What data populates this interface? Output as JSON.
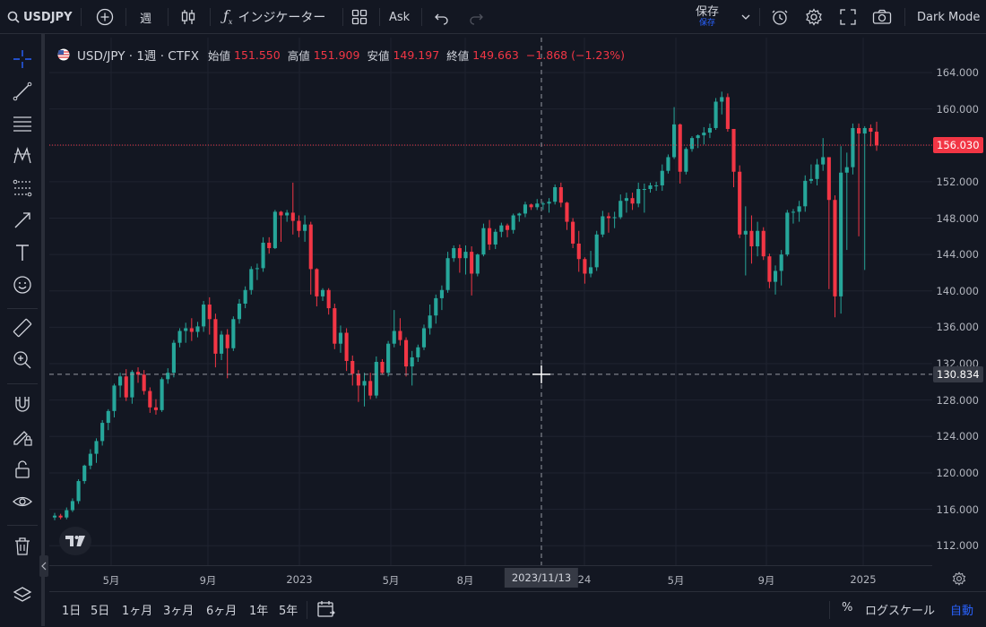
{
  "toolbar": {
    "symbol": "USDJPY",
    "interval": "週",
    "indicators": "インジケーター",
    "ask": "Ask",
    "save": "保存",
    "save_sub": "保存",
    "theme": "Dark Mode"
  },
  "legend": {
    "title": "USD/JPY · 1週 · CTFX",
    "open_label": "始値",
    "open": "151.550",
    "high_label": "高値",
    "high": "151.909",
    "low_label": "安値",
    "low": "149.197",
    "close_label": "終値",
    "close": "149.663",
    "change": "−1.868 (−1.23%)"
  },
  "price_axis": [
    "164.000",
    "160.000",
    "156.000",
    "152.000",
    "148.000",
    "144.000",
    "140.000",
    "136.000",
    "132.000",
    "128.000",
    "124.000",
    "120.000",
    "116.000",
    "112.000"
  ],
  "time_axis": [
    "5月",
    "9月",
    "2023",
    "5月",
    "8月",
    "24",
    "5月",
    "9月",
    "2025"
  ],
  "crosshair": {
    "price": "130.834",
    "date": "2023/11/13"
  },
  "last_price": "156.030",
  "bottom": {
    "ranges": [
      "1日",
      "5日",
      "1ヶ月",
      "3ヶ月",
      "6ヶ月",
      "1年",
      "5年"
    ],
    "percent": "%",
    "log": "ログスケール",
    "auto": "自動"
  },
  "colors": {
    "up": "#26a69a",
    "down": "#f23645",
    "bg": "#131722",
    "grid": "#1f2330",
    "auto": "#2962ff"
  },
  "chart_data": {
    "type": "candlestick",
    "symbol": "USD/JPY",
    "interval": "1週",
    "ylim": [
      110,
      166
    ],
    "candles": [
      [
        115.1,
        115.6,
        114.8,
        115.3
      ],
      [
        115.3,
        115.5,
        114.9,
        115.1
      ],
      [
        115.1,
        116.2,
        114.9,
        115.9
      ],
      [
        115.9,
        117.2,
        115.7,
        116.9
      ],
      [
        116.9,
        119.3,
        116.6,
        119.1
      ],
      [
        119.1,
        120.9,
        118.8,
        120.8
      ],
      [
        120.8,
        122.6,
        120.4,
        122.1
      ],
      [
        122.1,
        123.8,
        121.1,
        123.5
      ],
      [
        123.5,
        125.8,
        123.0,
        125.5
      ],
      [
        125.5,
        127.0,
        124.7,
        126.8
      ],
      [
        126.8,
        129.8,
        126.1,
        129.6
      ],
      [
        129.6,
        131.0,
        128.3,
        130.6
      ],
      [
        130.6,
        131.4,
        127.9,
        128.3
      ],
      [
        128.3,
        131.3,
        127.6,
        131.1
      ],
      [
        131.1,
        131.6,
        129.9,
        130.8
      ],
      [
        130.8,
        131.3,
        128.6,
        129.0
      ],
      [
        129.0,
        129.4,
        126.6,
        127.2
      ],
      [
        127.2,
        128.1,
        126.4,
        126.9
      ],
      [
        126.9,
        130.5,
        126.7,
        130.3
      ],
      [
        130.3,
        131.5,
        129.8,
        131.0
      ],
      [
        131.0,
        134.6,
        130.5,
        134.3
      ],
      [
        134.3,
        135.9,
        133.8,
        135.6
      ],
      [
        135.6,
        136.5,
        134.3,
        135.9
      ],
      [
        135.9,
        137.0,
        134.5,
        135.5
      ],
      [
        135.5,
        136.6,
        134.9,
        136.1
      ],
      [
        136.1,
        138.9,
        135.5,
        138.5
      ],
      [
        138.5,
        139.3,
        135.2,
        136.9
      ],
      [
        136.9,
        137.5,
        131.6,
        133.1
      ],
      [
        133.1,
        135.6,
        132.4,
        135.2
      ],
      [
        135.2,
        135.8,
        130.4,
        133.7
      ],
      [
        133.7,
        137.2,
        133.4,
        136.9
      ],
      [
        136.9,
        139.1,
        136.4,
        138.6
      ],
      [
        138.6,
        140.5,
        138.1,
        140.1
      ],
      [
        140.1,
        142.7,
        139.6,
        142.4
      ],
      [
        142.4,
        143.0,
        141.2,
        142.5
      ],
      [
        142.5,
        145.9,
        142.1,
        145.3
      ],
      [
        145.3,
        145.9,
        144.1,
        144.7
      ],
      [
        144.7,
        148.9,
        144.6,
        148.7
      ],
      [
        148.7,
        148.8,
        145.4,
        148.3
      ],
      [
        148.3,
        148.9,
        147.6,
        148.6
      ],
      [
        148.6,
        151.9,
        146.2,
        147.7
      ],
      [
        147.7,
        148.3,
        145.9,
        146.6
      ],
      [
        146.6,
        148.3,
        145.4,
        147.3
      ],
      [
        147.3,
        147.6,
        139.6,
        142.4
      ],
      [
        142.4,
        142.5,
        138.3,
        139.4
      ],
      [
        139.4,
        140.3,
        138.9,
        140.1
      ],
      [
        140.1,
        140.3,
        137.4,
        138.1
      ],
      [
        138.1,
        138.6,
        133.6,
        134.2
      ],
      [
        134.2,
        136.2,
        133.2,
        135.4
      ],
      [
        135.4,
        135.9,
        131.2,
        132.3
      ],
      [
        132.3,
        132.9,
        129.6,
        130.9
      ],
      [
        130.9,
        131.3,
        127.8,
        129.6
      ],
      [
        129.6,
        131.0,
        127.3,
        130.1
      ],
      [
        130.1,
        131.0,
        128.1,
        128.5
      ],
      [
        128.5,
        132.8,
        128.2,
        132.2
      ],
      [
        132.2,
        132.5,
        130.8,
        131.0
      ],
      [
        131.0,
        134.5,
        130.6,
        134.2
      ],
      [
        134.2,
        137.9,
        133.8,
        135.6
      ],
      [
        135.6,
        137.0,
        134.0,
        134.6
      ],
      [
        134.6,
        134.9,
        130.6,
        131.7
      ],
      [
        131.7,
        133.4,
        129.6,
        132.7
      ],
      [
        132.7,
        134.1,
        132.2,
        133.8
      ],
      [
        133.8,
        136.3,
        133.5,
        135.9
      ],
      [
        135.9,
        138.5,
        135.2,
        137.3
      ],
      [
        137.3,
        139.6,
        136.4,
        139.2
      ],
      [
        139.2,
        140.6,
        137.9,
        140.1
      ],
      [
        140.1,
        144.3,
        139.8,
        143.6
      ],
      [
        143.6,
        145.0,
        143.2,
        144.7
      ],
      [
        144.7,
        145.1,
        142.0,
        143.6
      ],
      [
        143.6,
        145.0,
        141.8,
        144.3
      ],
      [
        144.3,
        144.9,
        139.5,
        141.9
      ],
      [
        141.9,
        144.1,
        141.6,
        144.0
      ],
      [
        144.0,
        147.4,
        143.8,
        146.9
      ],
      [
        146.9,
        147.8,
        144.5,
        145.1
      ],
      [
        145.1,
        146.8,
        144.6,
        146.5
      ],
      [
        146.5,
        147.5,
        145.9,
        147.2
      ],
      [
        147.2,
        147.4,
        145.9,
        146.7
      ],
      [
        146.7,
        148.5,
        146.3,
        148.3
      ],
      [
        148.3,
        148.6,
        147.6,
        148.5
      ],
      [
        148.5,
        149.8,
        148.1,
        149.5
      ],
      [
        149.5,
        149.6,
        148.9,
        149.2
      ],
      [
        149.2,
        150.1,
        148.9,
        149.6
      ],
      [
        149.6,
        149.8,
        148.9,
        149.6
      ],
      [
        149.6,
        150.2,
        148.6,
        149.8
      ],
      [
        149.8,
        151.7,
        149.5,
        151.4
      ],
      [
        151.4,
        151.9,
        149.2,
        149.7
      ],
      [
        149.7,
        149.8,
        146.7,
        147.6
      ],
      [
        147.6,
        148.0,
        144.7,
        145.2
      ],
      [
        145.2,
        146.6,
        142.1,
        143.5
      ],
      [
        143.5,
        143.7,
        140.8,
        141.9
      ],
      [
        141.9,
        144.4,
        141.5,
        142.6
      ],
      [
        142.6,
        146.6,
        142.2,
        146.2
      ],
      [
        146.2,
        148.8,
        145.9,
        148.2
      ],
      [
        148.2,
        148.6,
        146.4,
        148.0
      ],
      [
        148.0,
        148.7,
        146.9,
        148.1
      ],
      [
        148.1,
        150.6,
        147.9,
        149.9
      ],
      [
        149.9,
        150.8,
        148.6,
        150.2
      ],
      [
        150.2,
        150.8,
        148.9,
        149.6
      ],
      [
        149.6,
        151.9,
        149.2,
        151.2
      ],
      [
        151.2,
        151.8,
        148.6,
        151.2
      ],
      [
        151.2,
        151.9,
        150.8,
        151.6
      ],
      [
        151.6,
        152.0,
        151.0,
        151.6
      ],
      [
        151.6,
        153.9,
        151.0,
        153.2
      ],
      [
        153.2,
        155.0,
        152.9,
        154.7
      ],
      [
        154.7,
        160.2,
        154.5,
        158.3
      ],
      [
        158.3,
        158.4,
        151.8,
        153.1
      ],
      [
        153.1,
        155.8,
        152.8,
        155.6
      ],
      [
        155.6,
        157.0,
        155.3,
        156.8
      ],
      [
        156.8,
        157.2,
        155.7,
        157.1
      ],
      [
        157.1,
        158.0,
        156.1,
        157.4
      ],
      [
        157.4,
        158.4,
        156.8,
        157.9
      ],
      [
        157.9,
        161.2,
        157.7,
        160.8
      ],
      [
        160.8,
        161.9,
        159.4,
        161.3
      ],
      [
        161.3,
        161.7,
        157.5,
        157.8
      ],
      [
        157.8,
        157.8,
        151.4,
        153.1
      ],
      [
        153.1,
        153.8,
        145.8,
        146.2
      ],
      [
        146.2,
        149.3,
        141.7,
        146.6
      ],
      [
        146.6,
        148.3,
        143.0,
        144.9
      ],
      [
        144.9,
        147.6,
        143.8,
        146.6
      ],
      [
        146.6,
        147.0,
        143.4,
        143.8
      ],
      [
        143.8,
        144.1,
        140.3,
        141.0
      ],
      [
        141.0,
        142.8,
        139.6,
        142.2
      ],
      [
        142.2,
        144.5,
        140.6,
        144.0
      ],
      [
        144.0,
        148.9,
        143.8,
        148.6
      ],
      [
        148.6,
        149.0,
        147.4,
        148.7
      ],
      [
        148.7,
        149.9,
        147.6,
        149.3
      ],
      [
        149.3,
        152.7,
        148.7,
        152.1
      ],
      [
        152.1,
        153.9,
        151.8,
        152.3
      ],
      [
        152.3,
        154.5,
        151.6,
        153.9
      ],
      [
        153.9,
        156.8,
        153.2,
        154.7
      ],
      [
        154.7,
        154.7,
        140.2,
        150.0
      ],
      [
        150.0,
        150.5,
        137.1,
        139.4
      ],
      [
        139.4,
        155.9,
        137.5,
        153.0
      ],
      [
        153.0,
        155.2,
        144.5,
        153.6
      ],
      [
        153.6,
        158.4,
        152.8,
        157.9
      ],
      [
        157.9,
        158.4,
        146.0,
        157.3
      ],
      [
        157.3,
        158.1,
        142.3,
        157.9
      ],
      [
        157.9,
        158.3,
        155.9,
        157.5
      ],
      [
        157.5,
        158.6,
        155.4,
        156.0
      ]
    ]
  }
}
